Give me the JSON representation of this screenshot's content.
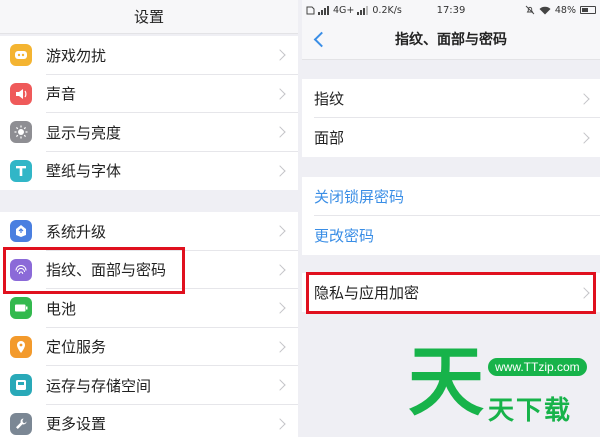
{
  "left": {
    "title": "设置",
    "groups": [
      [
        {
          "label": "游戏勿扰",
          "icon": "game-controller-icon",
          "color": "#f4b431"
        },
        {
          "label": "声音",
          "icon": "speaker-icon",
          "color": "#ef5a5a"
        },
        {
          "label": "显示与亮度",
          "icon": "brightness-icon",
          "color": "#8e8e93"
        },
        {
          "label": "壁纸与字体",
          "icon": "font-t-icon",
          "color": "#31b6c7"
        }
      ],
      [
        {
          "label": "系统升级",
          "icon": "update-icon",
          "color": "#4a7fe0"
        },
        {
          "label": "指纹、面部与密码",
          "icon": "fingerprint-icon",
          "color": "#8b6ad8"
        },
        {
          "label": "电池",
          "icon": "battery-icon",
          "color": "#33b94e"
        },
        {
          "label": "定位服务",
          "icon": "location-pin-icon",
          "color": "#f39a2c"
        },
        {
          "label": "运存与存储空间",
          "icon": "storage-icon",
          "color": "#29a9b8"
        },
        {
          "label": "更多设置",
          "icon": "wrench-icon",
          "color": "#7b8794"
        }
      ]
    ]
  },
  "right": {
    "status": {
      "signal": "4G+",
      "speed": "0.2K/s",
      "time": "17:39",
      "battery": "48%",
      "battery_level": 0.48
    },
    "title": "指纹、面部与密码",
    "group1": [
      "指纹",
      "面部"
    ],
    "group2": [
      "关闭锁屏密码",
      "更改密码"
    ],
    "group3": [
      "隐私与应用加密"
    ]
  },
  "watermark": {
    "big": "天",
    "url": "www.TTzip.com",
    "sub": "天下载"
  },
  "colors": {
    "highlight": "#e0101e",
    "accent": "#3a8ee6",
    "watermark": "#17b34a"
  }
}
